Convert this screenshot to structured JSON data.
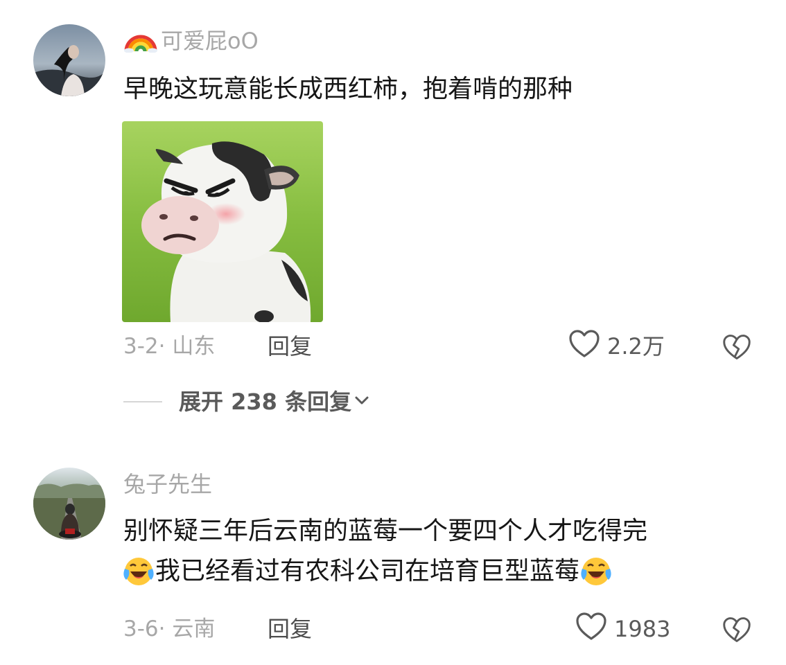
{
  "comments": [
    {
      "username": "可爱屁oO",
      "username_prefix_icon": "rainbow-icon",
      "text": "早晚这玩意能长成西红柿，抱着啃的那种",
      "sticker": "angry-cow-sticker",
      "date": "3-2",
      "location": "山东",
      "meta": "3-2· 山东",
      "reply_label": "回复",
      "likes": "2.2万",
      "expand_replies_label": "展开 238 条回复"
    },
    {
      "username": "兔子先生",
      "text_lines": [
        "别怀疑三年后云南的蓝莓一个要四个人才吃得完",
        "我已经看过有农科公司在培育巨型蓝莓"
      ],
      "emoji": "crying-laughing-face",
      "date": "3-6",
      "location": "云南",
      "meta": "3-6· 云南",
      "reply_label": "回复",
      "likes": "1983"
    }
  ],
  "colors": {
    "username": "#a7a7a7",
    "text": "#161616",
    "meta": "#a7a7a7",
    "action": "#4d4d4d",
    "background": "#ffffff"
  }
}
